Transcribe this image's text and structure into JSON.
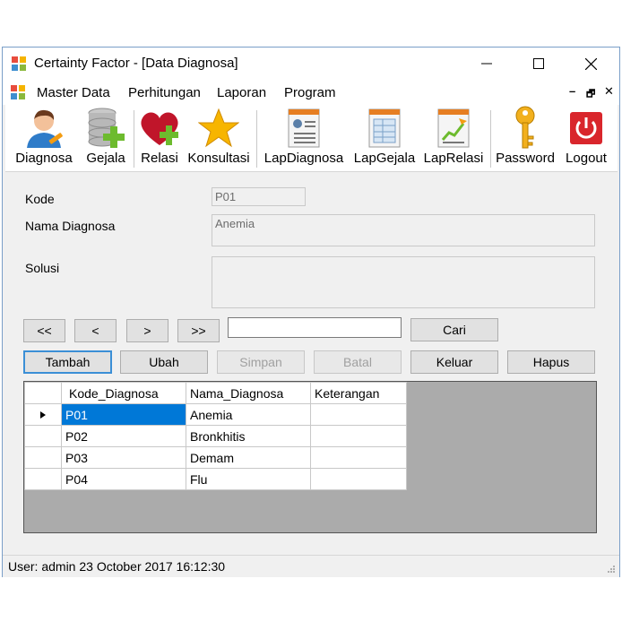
{
  "window": {
    "title": "Certainty Factor - [Data Diagnosa]"
  },
  "menu": [
    "Master Data",
    "Perhitungan",
    "Laporan",
    "Program"
  ],
  "mdi_controls": {
    "min": "–",
    "restore": "🗗",
    "close": "✕"
  },
  "toolbar": {
    "diagnosa": "Diagnosa",
    "gejala": "Gejala",
    "relasi": "Relasi",
    "konsultasi": "Konsultasi",
    "lapdiagnosa": "LapDiagnosa",
    "lapgejala": "LapGejala",
    "laprelasi": "LapRelasi",
    "password": "Password",
    "logout": "Logout"
  },
  "form": {
    "kode_label": "Kode",
    "kode_value": "P01",
    "nama_label": "Nama Diagnosa",
    "nama_value": "Anemia",
    "solusi_label": "Solusi",
    "solusi_value": ""
  },
  "nav": {
    "first": "<<",
    "prev": "<",
    "next": ">",
    "last": ">>",
    "search_value": "",
    "cari": "Cari"
  },
  "actions": {
    "tambah": "Tambah",
    "ubah": "Ubah",
    "simpan": "Simpan",
    "batal": "Batal",
    "keluar": "Keluar",
    "hapus": "Hapus"
  },
  "grid": {
    "columns": [
      "Kode_Diagnosa",
      "Nama_Diagnosa",
      "Keterangan"
    ],
    "rows": [
      {
        "kode": "P01",
        "nama": "Anemia",
        "ket": ""
      },
      {
        "kode": "P02",
        "nama": "Bronkhitis",
        "ket": ""
      },
      {
        "kode": "P03",
        "nama": "Demam",
        "ket": ""
      },
      {
        "kode": "P04",
        "nama": "Flu",
        "ket": ""
      }
    ]
  },
  "status": {
    "text": "User: admin   23 October 2017 16:12:30"
  }
}
